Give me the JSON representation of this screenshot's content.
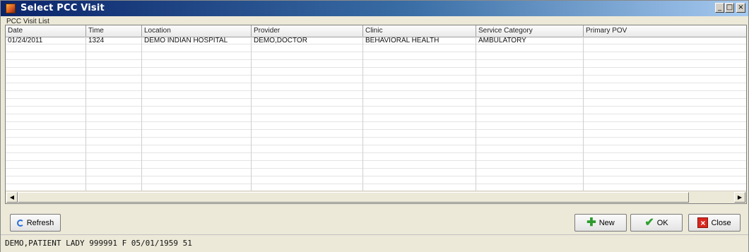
{
  "window": {
    "title": "Select PCC Visit",
    "controls": {
      "minimize": "_",
      "maximize": "□",
      "close": "×"
    }
  },
  "grid": {
    "group_label": "PCC Visit List",
    "columns": [
      "Date",
      "Time",
      "Location",
      "Provider",
      "Clinic",
      "Service Category",
      "Primary POV"
    ],
    "rows": [
      [
        "01/24/2011",
        "1324",
        "DEMO INDIAN HOSPITAL",
        "DEMO,DOCTOR",
        "BEHAVIORAL HEALTH",
        "AMBULATORY",
        ""
      ]
    ]
  },
  "buttons": {
    "refresh": "Refresh",
    "new": "New",
    "ok": "OK",
    "close": "Close"
  },
  "icons": {
    "app": "pcc-visit-app-icon",
    "refresh": "refresh-icon",
    "new": "plus-icon",
    "ok": "check-icon",
    "close": "close-box-icon"
  },
  "status": {
    "patient": "DEMO,PATIENT LADY 999991  F 05/01/1959 51"
  }
}
